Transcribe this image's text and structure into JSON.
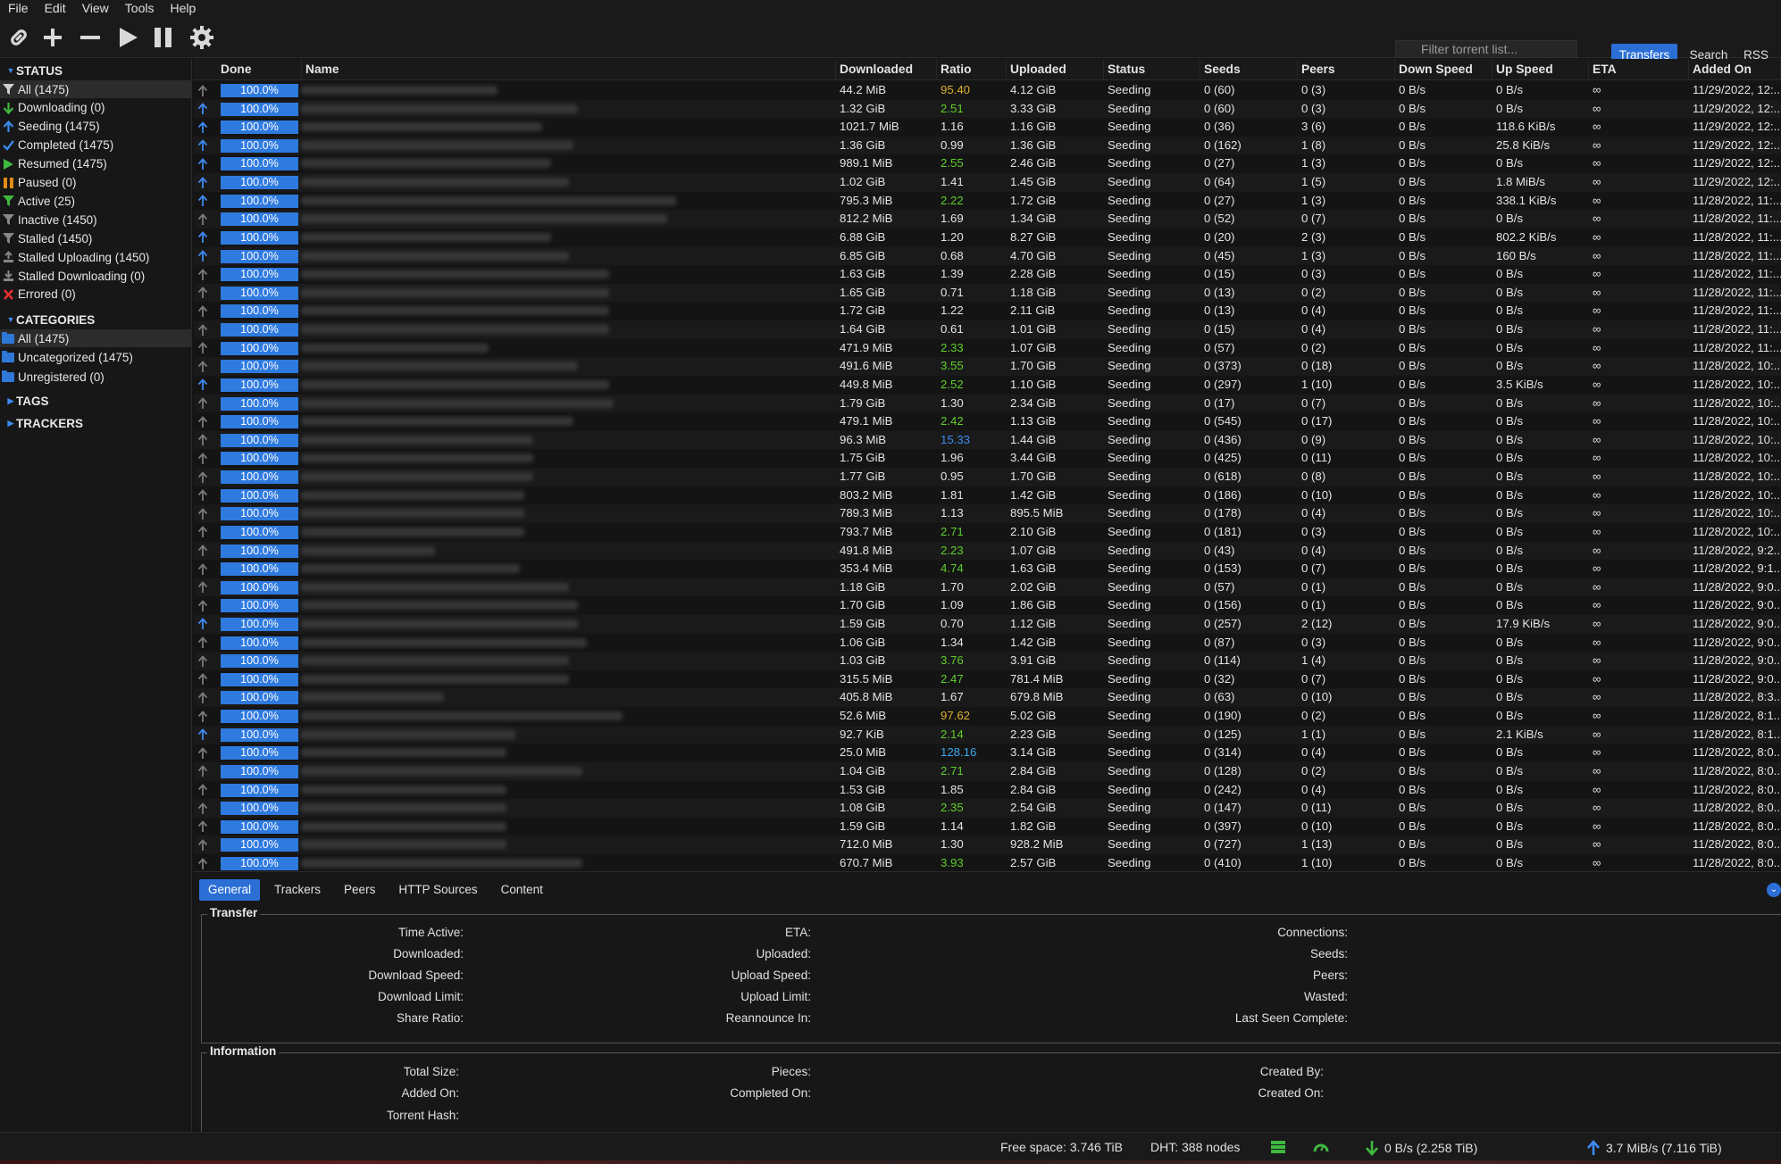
{
  "menu": [
    "File",
    "Edit",
    "View",
    "Tools",
    "Help"
  ],
  "toolbar": {
    "filter_placeholder": "Filter torrent list...",
    "transfers_label": "Transfers",
    "search_label": "Search",
    "rss_label": "RSS",
    "accent_color": "#2b6fd6"
  },
  "sidebar": {
    "status_header": "STATUS",
    "status": [
      {
        "label": "All (1475)",
        "icon": "filter-icon",
        "color": "#cfcfcf"
      },
      {
        "label": "Downloading (0)",
        "icon": "download-arrow-icon",
        "color": "#3fb83f"
      },
      {
        "label": "Seeding (1475)",
        "icon": "upload-arrow-icon",
        "color": "#3d8af0"
      },
      {
        "label": "Completed (1475)",
        "icon": "checkmark-icon",
        "color": "#3d8af0"
      },
      {
        "label": "Resumed (1475)",
        "icon": "play-icon",
        "color": "#3fb83f"
      },
      {
        "label": "Paused (0)",
        "icon": "pause-icon",
        "color": "#e08a1a"
      },
      {
        "label": "Active (25)",
        "icon": "filter-icon",
        "color": "#3fb83f"
      },
      {
        "label": "Inactive (1450)",
        "icon": "filter-icon",
        "color": "#888888"
      },
      {
        "label": "Stalled (1450)",
        "icon": "filter-icon",
        "color": "#888888"
      },
      {
        "label": "Stalled Uploading (1450)",
        "icon": "stalled-upload-icon",
        "color": "#888888"
      },
      {
        "label": "Stalled Downloading (0)",
        "icon": "stalled-download-icon",
        "color": "#888888"
      },
      {
        "label": "Errored (0)",
        "icon": "error-x-icon",
        "color": "#e03030"
      }
    ],
    "categories_header": "CATEGORIES",
    "categories": [
      "All (1475)",
      "Uncategorized (1475)",
      "Unregistered (0)"
    ],
    "tags_header": "TAGS",
    "trackers_header": "TRACKERS"
  },
  "columns": [
    "Done",
    "Name",
    "Downloaded",
    "Ratio",
    "Uploaded",
    "Status",
    "Seeds",
    "Peers",
    "Down Speed",
    "Up Speed",
    "ETA",
    "Added On"
  ],
  "torrents": [
    {
      "active": false,
      "done": "100.0%",
      "downloaded": "44.2 MiB",
      "ratio": "95.40",
      "ratio_color": "#e0b030",
      "uploaded": "4.12 GiB",
      "status": "Seeding",
      "seeds": "0 (60)",
      "peers": "0 (3)",
      "down": "0 B/s",
      "up": "0 B/s",
      "eta": "∞",
      "added": "11/29/2022, 12:..."
    },
    {
      "active": true,
      "done": "100.0%",
      "downloaded": "1.32 GiB",
      "ratio": "2.51",
      "ratio_color": "#5ecf2a",
      "uploaded": "3.33 GiB",
      "status": "Seeding",
      "seeds": "0 (60)",
      "peers": "0 (3)",
      "down": "0 B/s",
      "up": "0 B/s",
      "eta": "∞",
      "added": "11/29/2022, 12:..."
    },
    {
      "active": true,
      "done": "100.0%",
      "downloaded": "1021.7 MiB",
      "ratio": "1.16",
      "ratio_color": "#e4e4e4",
      "uploaded": "1.16 GiB",
      "status": "Seeding",
      "seeds": "0 (36)",
      "peers": "3 (6)",
      "down": "0 B/s",
      "up": "118.6 KiB/s",
      "eta": "∞",
      "added": "11/29/2022, 12:..."
    },
    {
      "active": true,
      "done": "100.0%",
      "downloaded": "1.36 GiB",
      "ratio": "0.99",
      "ratio_color": "#e4e4e4",
      "uploaded": "1.36 GiB",
      "status": "Seeding",
      "seeds": "0 (162)",
      "peers": "1 (8)",
      "down": "0 B/s",
      "up": "25.8 KiB/s",
      "eta": "∞",
      "added": "11/29/2022, 12:..."
    },
    {
      "active": true,
      "done": "100.0%",
      "downloaded": "989.1 MiB",
      "ratio": "2.55",
      "ratio_color": "#5ecf2a",
      "uploaded": "2.46 GiB",
      "status": "Seeding",
      "seeds": "0 (27)",
      "peers": "1 (3)",
      "down": "0 B/s",
      "up": "0 B/s",
      "eta": "∞",
      "added": "11/29/2022, 12:..."
    },
    {
      "active": true,
      "done": "100.0%",
      "downloaded": "1.02 GiB",
      "ratio": "1.41",
      "ratio_color": "#e4e4e4",
      "uploaded": "1.45 GiB",
      "status": "Seeding",
      "seeds": "0 (64)",
      "peers": "1 (5)",
      "down": "0 B/s",
      "up": "1.8 MiB/s",
      "eta": "∞",
      "added": "11/29/2022, 12:..."
    },
    {
      "active": true,
      "done": "100.0%",
      "downloaded": "795.3 MiB",
      "ratio": "2.22",
      "ratio_color": "#5ecf2a",
      "uploaded": "1.72 GiB",
      "status": "Seeding",
      "seeds": "0 (27)",
      "peers": "1 (3)",
      "down": "0 B/s",
      "up": "338.1 KiB/s",
      "eta": "∞",
      "added": "11/28/2022, 11:..."
    },
    {
      "active": false,
      "done": "100.0%",
      "downloaded": "812.2 MiB",
      "ratio": "1.69",
      "ratio_color": "#e4e4e4",
      "uploaded": "1.34 GiB",
      "status": "Seeding",
      "seeds": "0 (52)",
      "peers": "0 (7)",
      "down": "0 B/s",
      "up": "0 B/s",
      "eta": "∞",
      "added": "11/28/2022, 11:..."
    },
    {
      "active": true,
      "done": "100.0%",
      "downloaded": "6.88 GiB",
      "ratio": "1.20",
      "ratio_color": "#e4e4e4",
      "uploaded": "8.27 GiB",
      "status": "Seeding",
      "seeds": "0 (20)",
      "peers": "2 (3)",
      "down": "0 B/s",
      "up": "802.2 KiB/s",
      "eta": "∞",
      "added": "11/28/2022, 11:..."
    },
    {
      "active": true,
      "done": "100.0%",
      "downloaded": "6.85 GiB",
      "ratio": "0.68",
      "ratio_color": "#e4e4e4",
      "uploaded": "4.70 GiB",
      "status": "Seeding",
      "seeds": "0 (45)",
      "peers": "1 (3)",
      "down": "0 B/s",
      "up": "160 B/s",
      "eta": "∞",
      "added": "11/28/2022, 11:..."
    },
    {
      "active": false,
      "done": "100.0%",
      "downloaded": "1.63 GiB",
      "ratio": "1.39",
      "ratio_color": "#e4e4e4",
      "uploaded": "2.28 GiB",
      "status": "Seeding",
      "seeds": "0 (15)",
      "peers": "0 (3)",
      "down": "0 B/s",
      "up": "0 B/s",
      "eta": "∞",
      "added": "11/28/2022, 11:..."
    },
    {
      "active": false,
      "done": "100.0%",
      "downloaded": "1.65 GiB",
      "ratio": "0.71",
      "ratio_color": "#e4e4e4",
      "uploaded": "1.18 GiB",
      "status": "Seeding",
      "seeds": "0 (13)",
      "peers": "0 (2)",
      "down": "0 B/s",
      "up": "0 B/s",
      "eta": "∞",
      "added": "11/28/2022, 11:..."
    },
    {
      "active": false,
      "done": "100.0%",
      "downloaded": "1.72 GiB",
      "ratio": "1.22",
      "ratio_color": "#e4e4e4",
      "uploaded": "2.11 GiB",
      "status": "Seeding",
      "seeds": "0 (13)",
      "peers": "0 (4)",
      "down": "0 B/s",
      "up": "0 B/s",
      "eta": "∞",
      "added": "11/28/2022, 11:..."
    },
    {
      "active": false,
      "done": "100.0%",
      "downloaded": "1.64 GiB",
      "ratio": "0.61",
      "ratio_color": "#e4e4e4",
      "uploaded": "1.01 GiB",
      "status": "Seeding",
      "seeds": "0 (15)",
      "peers": "0 (4)",
      "down": "0 B/s",
      "up": "0 B/s",
      "eta": "∞",
      "added": "11/28/2022, 11:..."
    },
    {
      "active": false,
      "done": "100.0%",
      "downloaded": "471.9 MiB",
      "ratio": "2.33",
      "ratio_color": "#5ecf2a",
      "uploaded": "1.07 GiB",
      "status": "Seeding",
      "seeds": "0 (57)",
      "peers": "0 (2)",
      "down": "0 B/s",
      "up": "0 B/s",
      "eta": "∞",
      "added": "11/28/2022, 11:..."
    },
    {
      "active": false,
      "done": "100.0%",
      "downloaded": "491.6 MiB",
      "ratio": "3.55",
      "ratio_color": "#5ecf2a",
      "uploaded": "1.70 GiB",
      "status": "Seeding",
      "seeds": "0 (373)",
      "peers": "0 (18)",
      "down": "0 B/s",
      "up": "0 B/s",
      "eta": "∞",
      "added": "11/28/2022, 10:..."
    },
    {
      "active": true,
      "done": "100.0%",
      "downloaded": "449.8 MiB",
      "ratio": "2.52",
      "ratio_color": "#5ecf2a",
      "uploaded": "1.10 GiB",
      "status": "Seeding",
      "seeds": "0 (297)",
      "peers": "1 (10)",
      "down": "0 B/s",
      "up": "3.5 KiB/s",
      "eta": "∞",
      "added": "11/28/2022, 10:..."
    },
    {
      "active": false,
      "done": "100.0%",
      "downloaded": "1.79 GiB",
      "ratio": "1.30",
      "ratio_color": "#e4e4e4",
      "uploaded": "2.34 GiB",
      "status": "Seeding",
      "seeds": "0 (17)",
      "peers": "0 (7)",
      "down": "0 B/s",
      "up": "0 B/s",
      "eta": "∞",
      "added": "11/28/2022, 10:..."
    },
    {
      "active": false,
      "done": "100.0%",
      "downloaded": "479.1 MiB",
      "ratio": "2.42",
      "ratio_color": "#5ecf2a",
      "uploaded": "1.13 GiB",
      "status": "Seeding",
      "seeds": "0 (545)",
      "peers": "0 (17)",
      "down": "0 B/s",
      "up": "0 B/s",
      "eta": "∞",
      "added": "11/28/2022, 10:..."
    },
    {
      "active": false,
      "done": "100.0%",
      "downloaded": "96.3 MiB",
      "ratio": "15.33",
      "ratio_color": "#3d8af0",
      "uploaded": "1.44 GiB",
      "status": "Seeding",
      "seeds": "0 (436)",
      "peers": "0 (9)",
      "down": "0 B/s",
      "up": "0 B/s",
      "eta": "∞",
      "added": "11/28/2022, 10:..."
    },
    {
      "active": false,
      "done": "100.0%",
      "downloaded": "1.75 GiB",
      "ratio": "1.96",
      "ratio_color": "#e4e4e4",
      "uploaded": "3.44 GiB",
      "status": "Seeding",
      "seeds": "0 (425)",
      "peers": "0 (11)",
      "down": "0 B/s",
      "up": "0 B/s",
      "eta": "∞",
      "added": "11/28/2022, 10:..."
    },
    {
      "active": false,
      "done": "100.0%",
      "downloaded": "1.77 GiB",
      "ratio": "0.95",
      "ratio_color": "#e4e4e4",
      "uploaded": "1.70 GiB",
      "status": "Seeding",
      "seeds": "0 (618)",
      "peers": "0 (8)",
      "down": "0 B/s",
      "up": "0 B/s",
      "eta": "∞",
      "added": "11/28/2022, 10:..."
    },
    {
      "active": false,
      "done": "100.0%",
      "downloaded": "803.2 MiB",
      "ratio": "1.81",
      "ratio_color": "#e4e4e4",
      "uploaded": "1.42 GiB",
      "status": "Seeding",
      "seeds": "0 (186)",
      "peers": "0 (10)",
      "down": "0 B/s",
      "up": "0 B/s",
      "eta": "∞",
      "added": "11/28/2022, 10:..."
    },
    {
      "active": false,
      "done": "100.0%",
      "downloaded": "789.3 MiB",
      "ratio": "1.13",
      "ratio_color": "#e4e4e4",
      "uploaded": "895.5 MiB",
      "status": "Seeding",
      "seeds": "0 (178)",
      "peers": "0 (4)",
      "down": "0 B/s",
      "up": "0 B/s",
      "eta": "∞",
      "added": "11/28/2022, 10:..."
    },
    {
      "active": false,
      "done": "100.0%",
      "downloaded": "793.7 MiB",
      "ratio": "2.71",
      "ratio_color": "#5ecf2a",
      "uploaded": "2.10 GiB",
      "status": "Seeding",
      "seeds": "0 (181)",
      "peers": "0 (3)",
      "down": "0 B/s",
      "up": "0 B/s",
      "eta": "∞",
      "added": "11/28/2022, 10:..."
    },
    {
      "active": false,
      "done": "100.0%",
      "downloaded": "491.8 MiB",
      "ratio": "2.23",
      "ratio_color": "#5ecf2a",
      "uploaded": "1.07 GiB",
      "status": "Seeding",
      "seeds": "0 (43)",
      "peers": "0 (4)",
      "down": "0 B/s",
      "up": "0 B/s",
      "eta": "∞",
      "added": "11/28/2022, 9:2..."
    },
    {
      "active": false,
      "done": "100.0%",
      "downloaded": "353.4 MiB",
      "ratio": "4.74",
      "ratio_color": "#5ecf2a",
      "uploaded": "1.63 GiB",
      "status": "Seeding",
      "seeds": "0 (153)",
      "peers": "0 (7)",
      "down": "0 B/s",
      "up": "0 B/s",
      "eta": "∞",
      "added": "11/28/2022, 9:1..."
    },
    {
      "active": false,
      "done": "100.0%",
      "downloaded": "1.18 GiB",
      "ratio": "1.70",
      "ratio_color": "#e4e4e4",
      "uploaded": "2.02 GiB",
      "status": "Seeding",
      "seeds": "0 (57)",
      "peers": "0 (1)",
      "down": "0 B/s",
      "up": "0 B/s",
      "eta": "∞",
      "added": "11/28/2022, 9:0..."
    },
    {
      "active": false,
      "done": "100.0%",
      "downloaded": "1.70 GiB",
      "ratio": "1.09",
      "ratio_color": "#e4e4e4",
      "uploaded": "1.86 GiB",
      "status": "Seeding",
      "seeds": "0 (156)",
      "peers": "0 (1)",
      "down": "0 B/s",
      "up": "0 B/s",
      "eta": "∞",
      "added": "11/28/2022, 9:0..."
    },
    {
      "active": true,
      "done": "100.0%",
      "downloaded": "1.59 GiB",
      "ratio": "0.70",
      "ratio_color": "#e4e4e4",
      "uploaded": "1.12 GiB",
      "status": "Seeding",
      "seeds": "0 (257)",
      "peers": "2 (12)",
      "down": "0 B/s",
      "up": "17.9 KiB/s",
      "eta": "∞",
      "added": "11/28/2022, 9:0..."
    },
    {
      "active": false,
      "done": "100.0%",
      "downloaded": "1.06 GiB",
      "ratio": "1.34",
      "ratio_color": "#e4e4e4",
      "uploaded": "1.42 GiB",
      "status": "Seeding",
      "seeds": "0 (87)",
      "peers": "0 (3)",
      "down": "0 B/s",
      "up": "0 B/s",
      "eta": "∞",
      "added": "11/28/2022, 9:0..."
    },
    {
      "active": false,
      "done": "100.0%",
      "downloaded": "1.03 GiB",
      "ratio": "3.76",
      "ratio_color": "#5ecf2a",
      "uploaded": "3.91 GiB",
      "status": "Seeding",
      "seeds": "0 (114)",
      "peers": "1 (4)",
      "down": "0 B/s",
      "up": "0 B/s",
      "eta": "∞",
      "added": "11/28/2022, 9:0..."
    },
    {
      "active": false,
      "done": "100.0%",
      "downloaded": "315.5 MiB",
      "ratio": "2.47",
      "ratio_color": "#5ecf2a",
      "uploaded": "781.4 MiB",
      "status": "Seeding",
      "seeds": "0 (32)",
      "peers": "0 (7)",
      "down": "0 B/s",
      "up": "0 B/s",
      "eta": "∞",
      "added": "11/28/2022, 9:0..."
    },
    {
      "active": false,
      "done": "100.0%",
      "downloaded": "405.8 MiB",
      "ratio": "1.67",
      "ratio_color": "#e4e4e4",
      "uploaded": "679.8 MiB",
      "status": "Seeding",
      "seeds": "0 (63)",
      "peers": "0 (10)",
      "down": "0 B/s",
      "up": "0 B/s",
      "eta": "∞",
      "added": "11/28/2022, 8:3..."
    },
    {
      "active": false,
      "done": "100.0%",
      "downloaded": "52.6 MiB",
      "ratio": "97.62",
      "ratio_color": "#e0b030",
      "uploaded": "5.02 GiB",
      "status": "Seeding",
      "seeds": "0 (190)",
      "peers": "0 (2)",
      "down": "0 B/s",
      "up": "0 B/s",
      "eta": "∞",
      "added": "11/28/2022, 8:1..."
    },
    {
      "active": true,
      "done": "100.0%",
      "downloaded": "92.7 KiB",
      "ratio": "2.14",
      "ratio_color": "#5ecf2a",
      "uploaded": "2.23 GiB",
      "status": "Seeding",
      "seeds": "0 (125)",
      "peers": "1 (1)",
      "down": "0 B/s",
      "up": "2.1 KiB/s",
      "eta": "∞",
      "added": "11/28/2022, 8:1..."
    },
    {
      "active": false,
      "done": "100.0%",
      "downloaded": "25.0 MiB",
      "ratio": "128.16",
      "ratio_color": "#3da8f0",
      "uploaded": "3.14 GiB",
      "status": "Seeding",
      "seeds": "0 (314)",
      "peers": "0 (4)",
      "down": "0 B/s",
      "up": "0 B/s",
      "eta": "∞",
      "added": "11/28/2022, 8:0..."
    },
    {
      "active": false,
      "done": "100.0%",
      "downloaded": "1.04 GiB",
      "ratio": "2.71",
      "ratio_color": "#5ecf2a",
      "uploaded": "2.84 GiB",
      "status": "Seeding",
      "seeds": "0 (128)",
      "peers": "0 (2)",
      "down": "0 B/s",
      "up": "0 B/s",
      "eta": "∞",
      "added": "11/28/2022, 8:0..."
    },
    {
      "active": false,
      "done": "100.0%",
      "downloaded": "1.53 GiB",
      "ratio": "1.85",
      "ratio_color": "#e4e4e4",
      "uploaded": "2.84 GiB",
      "status": "Seeding",
      "seeds": "0 (242)",
      "peers": "0 (4)",
      "down": "0 B/s",
      "up": "0 B/s",
      "eta": "∞",
      "added": "11/28/2022, 8:0..."
    },
    {
      "active": false,
      "done": "100.0%",
      "downloaded": "1.08 GiB",
      "ratio": "2.35",
      "ratio_color": "#5ecf2a",
      "uploaded": "2.54 GiB",
      "status": "Seeding",
      "seeds": "0 (147)",
      "peers": "0 (11)",
      "down": "0 B/s",
      "up": "0 B/s",
      "eta": "∞",
      "added": "11/28/2022, 8:0..."
    },
    {
      "active": false,
      "done": "100.0%",
      "downloaded": "1.59 GiB",
      "ratio": "1.14",
      "ratio_color": "#e4e4e4",
      "uploaded": "1.82 GiB",
      "status": "Seeding",
      "seeds": "0 (397)",
      "peers": "0 (10)",
      "down": "0 B/s",
      "up": "0 B/s",
      "eta": "∞",
      "added": "11/28/2022, 8:0..."
    },
    {
      "active": false,
      "done": "100.0%",
      "downloaded": "712.0 MiB",
      "ratio": "1.30",
      "ratio_color": "#e4e4e4",
      "uploaded": "928.2 MiB",
      "status": "Seeding",
      "seeds": "0 (727)",
      "peers": "1 (13)",
      "down": "0 B/s",
      "up": "0 B/s",
      "eta": "∞",
      "added": "11/28/2022, 8:0..."
    },
    {
      "active": false,
      "done": "100.0%",
      "downloaded": "670.7 MiB",
      "ratio": "3.93",
      "ratio_color": "#5ecf2a",
      "uploaded": "2.57 GiB",
      "status": "Seeding",
      "seeds": "0 (410)",
      "peers": "1 (10)",
      "down": "0 B/s",
      "up": "0 B/s",
      "eta": "∞",
      "added": "11/28/2022, 8:0..."
    }
  ],
  "properties": {
    "tabs": [
      "General",
      "Trackers",
      "Peers",
      "HTTP Sources",
      "Content"
    ],
    "transfer_title": "Transfer",
    "transfer_col1": [
      "Time Active:",
      "Downloaded:",
      "Download Speed:",
      "Download Limit:",
      "Share Ratio:"
    ],
    "transfer_col2": [
      "ETA:",
      "Uploaded:",
      "Upload Speed:",
      "Upload Limit:",
      "Reannounce In:"
    ],
    "transfer_col3": [
      "Connections:",
      "Seeds:",
      "Peers:",
      "Wasted:",
      "Last Seen Complete:"
    ],
    "info_title": "Information",
    "info_col1": [
      "Total Size:",
      "Added On:",
      "Torrent Hash:"
    ],
    "info_col2": [
      "Pieces:",
      "Completed On:"
    ],
    "info_col3": [
      "Created By:",
      "Created On:"
    ]
  },
  "statusbar": {
    "free_space": "Free space: 3.746 TiB",
    "dht": "DHT: 388 nodes",
    "download": "0 B/s (2.258 TiB)",
    "upload": "3.7 MiB/s (7.116 TiB)"
  }
}
